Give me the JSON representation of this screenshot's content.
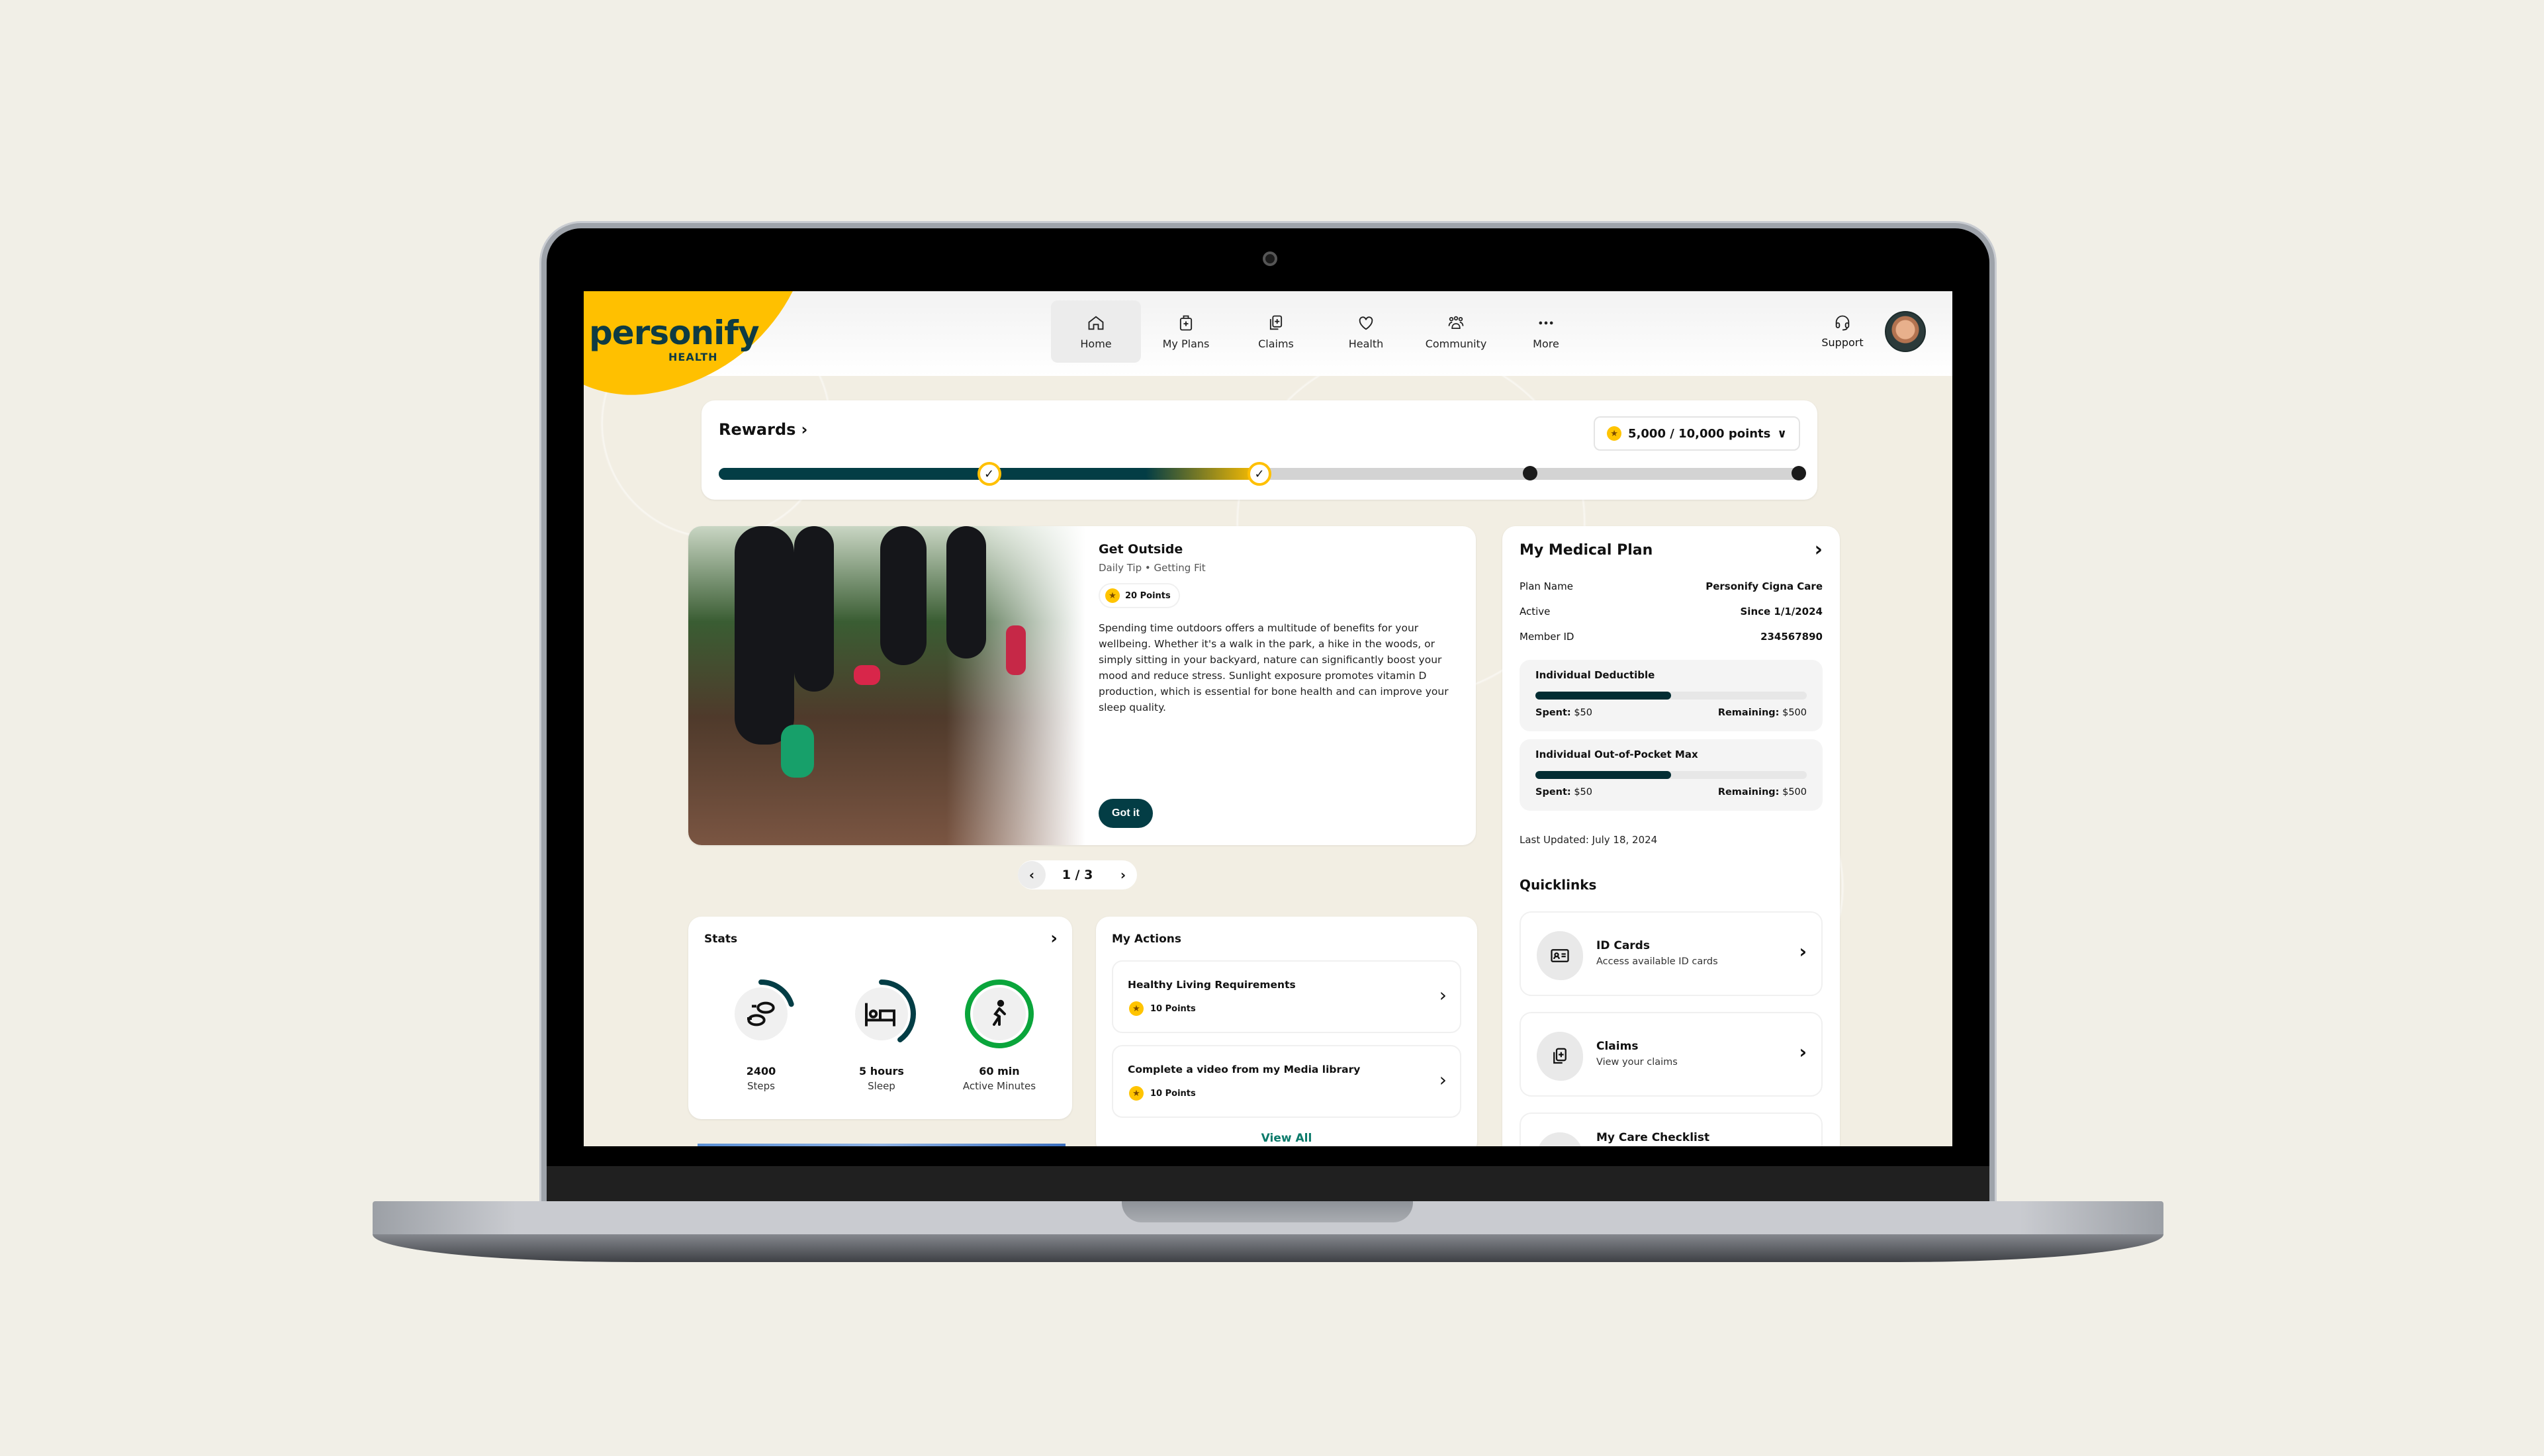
{
  "nav": {
    "brand": {
      "word": "personify",
      "sub": "HEALTH"
    },
    "items": [
      {
        "label": "Home",
        "icon": "home-icon",
        "active": true
      },
      {
        "label": "My Plans",
        "icon": "medical-kit-icon",
        "active": false
      },
      {
        "label": "Claims",
        "icon": "claims-icon",
        "active": false
      },
      {
        "label": "Health",
        "icon": "heart-icon",
        "active": false
      },
      {
        "label": "Community",
        "icon": "people-icon",
        "active": false
      },
      {
        "label": "More",
        "icon": "more-icon",
        "active": false
      }
    ],
    "support_label": "Support"
  },
  "rewards": {
    "title": "Rewards",
    "points_label": "5,000 / 10,000 points",
    "progress_fraction": 0.5,
    "milestones": [
      {
        "position": 0.25,
        "completed": true
      },
      {
        "position": 0.5,
        "completed": true
      },
      {
        "position": 0.75,
        "completed": false
      },
      {
        "position": 1.0,
        "completed": false
      }
    ],
    "check_glyph": "✓"
  },
  "tip": {
    "title": "Get Outside",
    "subtitle": "Daily Tip • Getting Fit",
    "points": "20 Points",
    "body": "Spending time outdoors offers a multitude of benefits for your wellbeing. Whether it's a walk in the park, a hike in the woods, or simply sitting in your backyard, nature can significantly boost your mood and reduce stress. Sunlight exposure promotes vitamin D production, which is essential for bone health and can improve your sleep quality.",
    "button": "Got it",
    "pager": "1 / 3"
  },
  "stats": {
    "title": "Stats",
    "items": [
      {
        "value": "2400",
        "label": "Steps",
        "icon": "footsteps-icon",
        "progress": 0.2,
        "color": "#033d45"
      },
      {
        "value": "5 hours",
        "label": "Sleep",
        "icon": "bed-icon",
        "progress": 0.4,
        "color": "#033d45"
      },
      {
        "value": "60 min",
        "label": "Active Minutes",
        "icon": "walking-icon",
        "progress": 1.0,
        "color": "#0aa53b"
      }
    ]
  },
  "actions": {
    "title": "My Actions",
    "items": [
      {
        "title": "Healthy Living Requirements",
        "points": "10 Points"
      },
      {
        "title": "Complete a video from my Media library",
        "points": "10 Points"
      }
    ],
    "view_all": "View All"
  },
  "plan": {
    "title": "My Medical Plan",
    "rows": [
      {
        "k": "Plan Name",
        "v": "Personify Cigna Care"
      },
      {
        "k": "Active",
        "v": "Since 1/1/2024"
      },
      {
        "k": "Member ID",
        "v": "234567890"
      }
    ],
    "meters": [
      {
        "title": "Individual Deductible",
        "spent_label": "Spent:",
        "spent": "$50",
        "remaining_label": "Remaining:",
        "remaining": "$500",
        "fraction": 0.5
      },
      {
        "title": "Individual Out-of-Pocket Max",
        "spent_label": "Spent:",
        "spent": "$50",
        "remaining_label": "Remaining:",
        "remaining": "$500",
        "fraction": 0.5
      }
    ],
    "last_updated": "Last Updated: July 18, 2024"
  },
  "quicklinks": {
    "title": "Quicklinks",
    "items": [
      {
        "name": "ID Cards",
        "desc": "Access available ID cards",
        "icon": "id-card-icon"
      },
      {
        "name": "Claims",
        "desc": "View your claims",
        "icon": "claims-icon"
      },
      {
        "name": "My Care Checklist",
        "desc": "",
        "icon": "checklist-icon"
      }
    ]
  },
  "colors": {
    "brand_yellow": "#ffc000",
    "brand_teal": "#033d45",
    "active_green": "#0aa53b",
    "link_teal": "#0a7a6a"
  },
  "glyphs": {
    "chevron_right": "›",
    "chevron_left": "‹",
    "chevron_down": "⌄",
    "star": "★"
  }
}
